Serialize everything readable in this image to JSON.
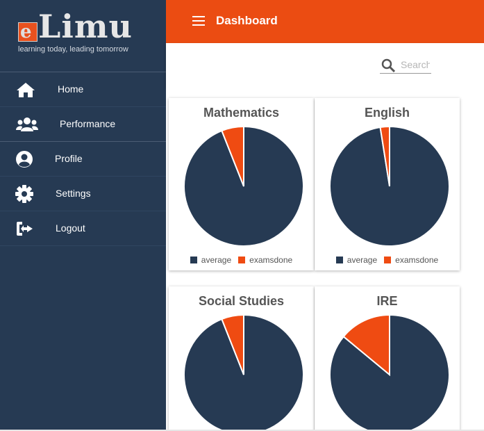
{
  "brand": {
    "logo_letter": "e",
    "logo_word": "Limu",
    "tagline": "learning today, leading tomorrow"
  },
  "colors": {
    "sidebar": "#263a53",
    "accent": "#eb4c12",
    "average": "#263a53",
    "examsdone": "#ef4b12"
  },
  "sidebar": {
    "items": [
      {
        "label": "Home",
        "icon": "home-icon"
      },
      {
        "label": "Performance",
        "icon": "users-icon"
      },
      {
        "label": "Profile",
        "icon": "user-circle-icon"
      },
      {
        "label": "Settings",
        "icon": "gear-icon"
      },
      {
        "label": "Logout",
        "icon": "logout-icon"
      }
    ]
  },
  "header": {
    "title": "Dashboard",
    "menu_icon": "menu-icon"
  },
  "search": {
    "placeholder": "Search",
    "icon": "search-icon"
  },
  "legend": {
    "average": "average",
    "examsdone": "examsdone"
  },
  "chart_data": [
    {
      "type": "pie",
      "title": "Mathematics",
      "labels": [
        "average",
        "examsdone"
      ],
      "values": [
        94,
        6
      ]
    },
    {
      "type": "pie",
      "title": "English",
      "labels": [
        "average",
        "examsdone"
      ],
      "values": [
        97.5,
        2.5
      ]
    },
    {
      "type": "pie",
      "title": "Social Studies",
      "labels": [
        "average",
        "examsdone"
      ],
      "values": [
        94,
        6
      ]
    },
    {
      "type": "pie",
      "title": "IRE",
      "labels": [
        "average",
        "examsdone"
      ],
      "values": [
        86,
        14
      ]
    }
  ]
}
